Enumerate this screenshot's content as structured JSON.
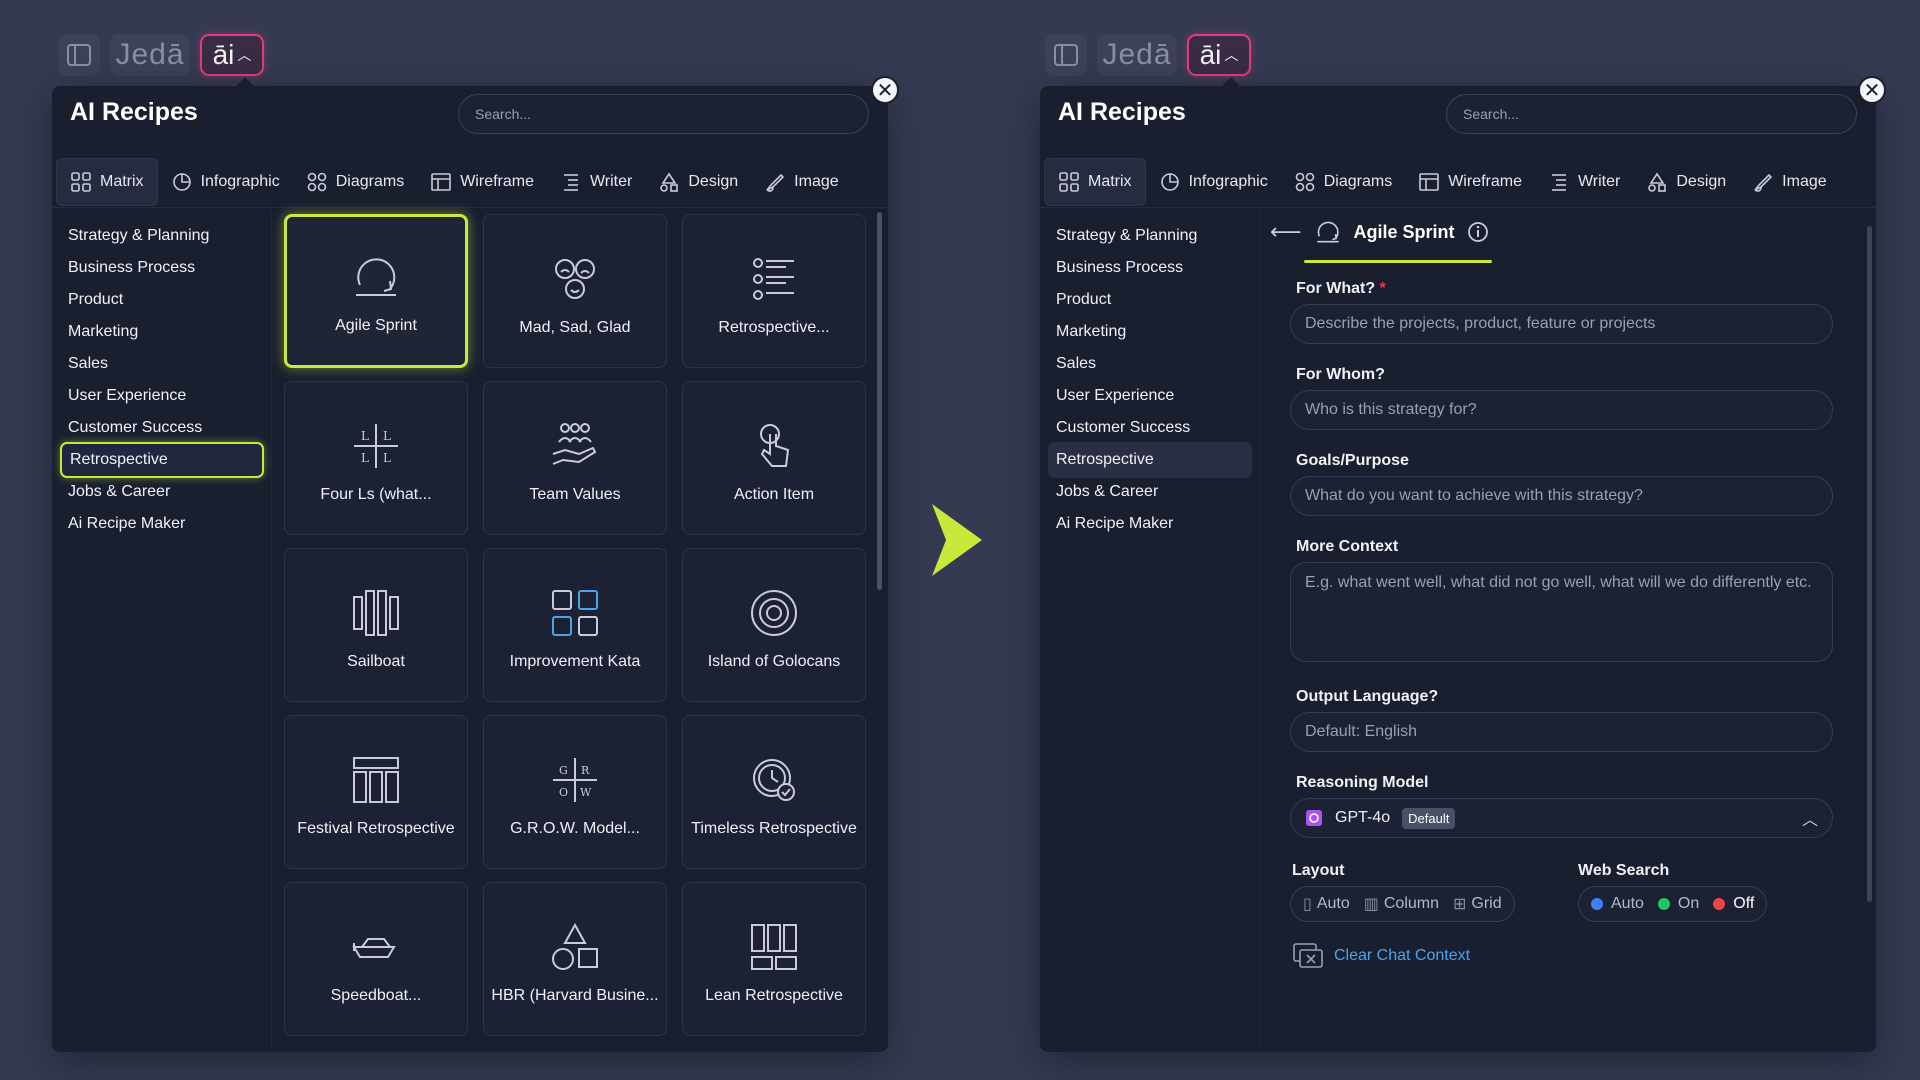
{
  "topbar": {
    "brand": "Jedā",
    "ai": "āi"
  },
  "left": {
    "title": "AI Recipes",
    "search_placeholder": "Search...",
    "tabs": [
      "Matrix",
      "Infographic",
      "Diagrams",
      "Wireframe",
      "Writer",
      "Design",
      "Image"
    ],
    "sidebar": [
      "Strategy & Planning",
      "Business Process",
      "Product",
      "Marketing",
      "Sales",
      "User Experience",
      "Customer Success",
      "Retrospective",
      "Jobs & Career",
      "Ai Recipe Maker"
    ],
    "cards": [
      {
        "label": "Agile Sprint",
        "icon": "agile-sprint-icon"
      },
      {
        "label": "Mad, Sad, Glad",
        "icon": "faces-icon"
      },
      {
        "label": "Retrospective...",
        "icon": "list-icon"
      },
      {
        "label": "Four Ls (what...",
        "icon": "four-ls-icon"
      },
      {
        "label": "Team Values",
        "icon": "team-hand-icon"
      },
      {
        "label": "Action Item",
        "icon": "pointer-icon"
      },
      {
        "label": "Sailboat",
        "icon": "sailboat-icon"
      },
      {
        "label": "Improvement Kata",
        "icon": "kata-grid-icon"
      },
      {
        "label": "Island of Golocans",
        "icon": "circles-icon"
      },
      {
        "label": "Festival Retrospective",
        "icon": "festival-icon"
      },
      {
        "label": "G.R.O.W. Model...",
        "icon": "grow-icon"
      },
      {
        "label": "Timeless Retrospective",
        "icon": "clock-check-icon"
      },
      {
        "label": "Speedboat...",
        "icon": "speedboat-icon"
      },
      {
        "label": "HBR (Harvard Busine...",
        "icon": "shapes-icon"
      },
      {
        "label": "Lean Retrospective",
        "icon": "lean-icon"
      }
    ]
  },
  "right": {
    "title": "AI Recipes",
    "search_placeholder": "Search...",
    "recipe_title": "Agile Sprint",
    "fields": {
      "for_what_label": "For What?",
      "required_mark": "*",
      "for_what_placeholder": "Describe the projects, product, feature or projects",
      "for_whom_label": "For Whom?",
      "for_whom_placeholder": "Who is this strategy for?",
      "goals_label": "Goals/Purpose",
      "goals_placeholder": "What do you want to achieve with this strategy?",
      "context_label": "More Context",
      "context_placeholder": "E.g. what went well, what did not go well, what will we do differently etc.",
      "lang_label": "Output Language?",
      "lang_placeholder": "Default: English",
      "model_label": "Reasoning Model",
      "model_value": "GPT-4o",
      "model_badge": "Default"
    },
    "layout": {
      "label": "Layout",
      "options": [
        "Auto",
        "Column",
        "Grid"
      ]
    },
    "web_search": {
      "label": "Web Search",
      "options": [
        "Auto",
        "On",
        "Off"
      ],
      "colors": [
        "#3b82f6",
        "#22c55e",
        "#ef4444"
      ]
    },
    "clear_label": "Clear Chat Context"
  },
  "colors": {
    "accent": "#c8e83a",
    "ai_pink": "#e23b7a",
    "link": "#4ba3e8"
  }
}
